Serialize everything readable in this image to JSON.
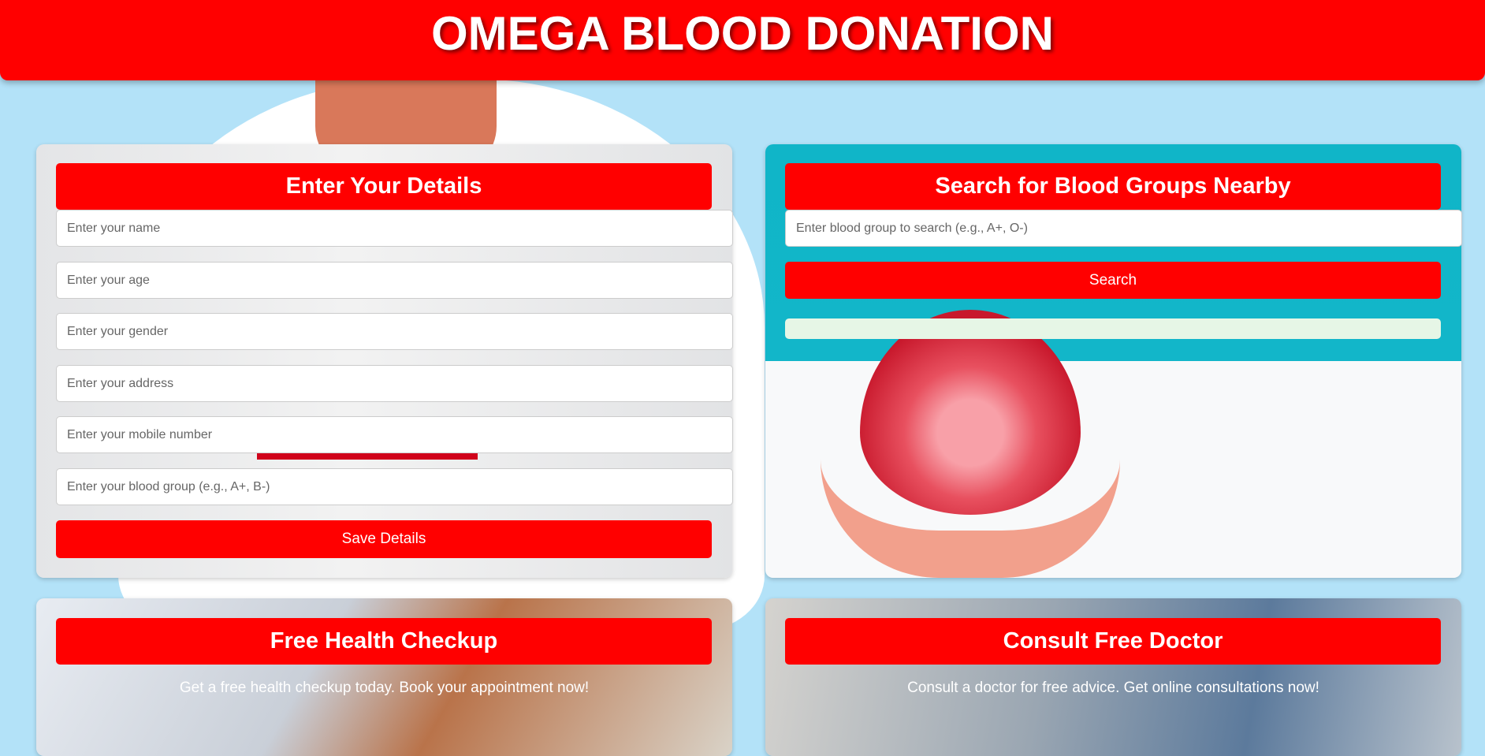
{
  "header": {
    "title": "OMEGA BLOOD DONATION"
  },
  "details": {
    "title": "Enter Your Details",
    "fields": [
      {
        "placeholder": "Enter your name"
      },
      {
        "placeholder": "Enter your age"
      },
      {
        "placeholder": "Enter your gender"
      },
      {
        "placeholder": "Enter your address"
      },
      {
        "placeholder": "Enter your mobile number"
      },
      {
        "placeholder": "Enter your blood group (e.g., A+, B-)"
      }
    ],
    "save_label": "Save Details"
  },
  "search": {
    "title": "Search for Blood Groups Nearby",
    "placeholder": "Enter blood group to search (e.g., A+, O-)",
    "button_label": "Search",
    "result": ""
  },
  "checkup": {
    "title": "Free Health Checkup",
    "text": "Get a free health checkup today. Book your appointment now!"
  },
  "doctor": {
    "title": "Consult Free Doctor",
    "text": "Consult a doctor for free advice. Get online consultations now!"
  },
  "colors": {
    "accent": "#ff0000",
    "background": "#b3e2f8",
    "result_box": "#e6f6e6"
  }
}
